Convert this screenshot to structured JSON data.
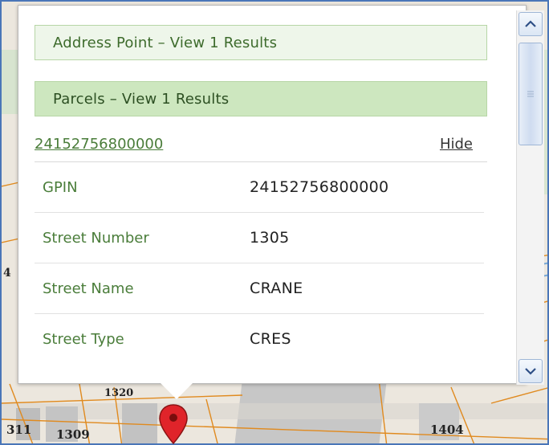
{
  "popup": {
    "layers": [
      {
        "label": "Address Point  –  View 1 Results"
      },
      {
        "label": "Parcels  –  View 1 Results"
      }
    ],
    "feature": {
      "id": "24152756800000",
      "hide_label": "Hide"
    },
    "attributes": [
      {
        "key": "GPIN",
        "value": "24152756800000"
      },
      {
        "key": "Street Number",
        "value": "1305"
      },
      {
        "key": "Street Name",
        "value": "CRANE"
      },
      {
        "key": "Street Type",
        "value": "CRES"
      }
    ]
  },
  "map": {
    "labels": [
      "311",
      "1309",
      "1404",
      "1320",
      "4"
    ]
  },
  "icons": {
    "scroll_up": "chevron-up-icon",
    "scroll_down": "chevron-down-icon",
    "pin": "map-pin-icon"
  },
  "colors": {
    "accent_green": "#4a7d3a",
    "header_light": "#eef6ea",
    "header_dark": "#cde7bf",
    "pin_red": "#e0242a"
  }
}
